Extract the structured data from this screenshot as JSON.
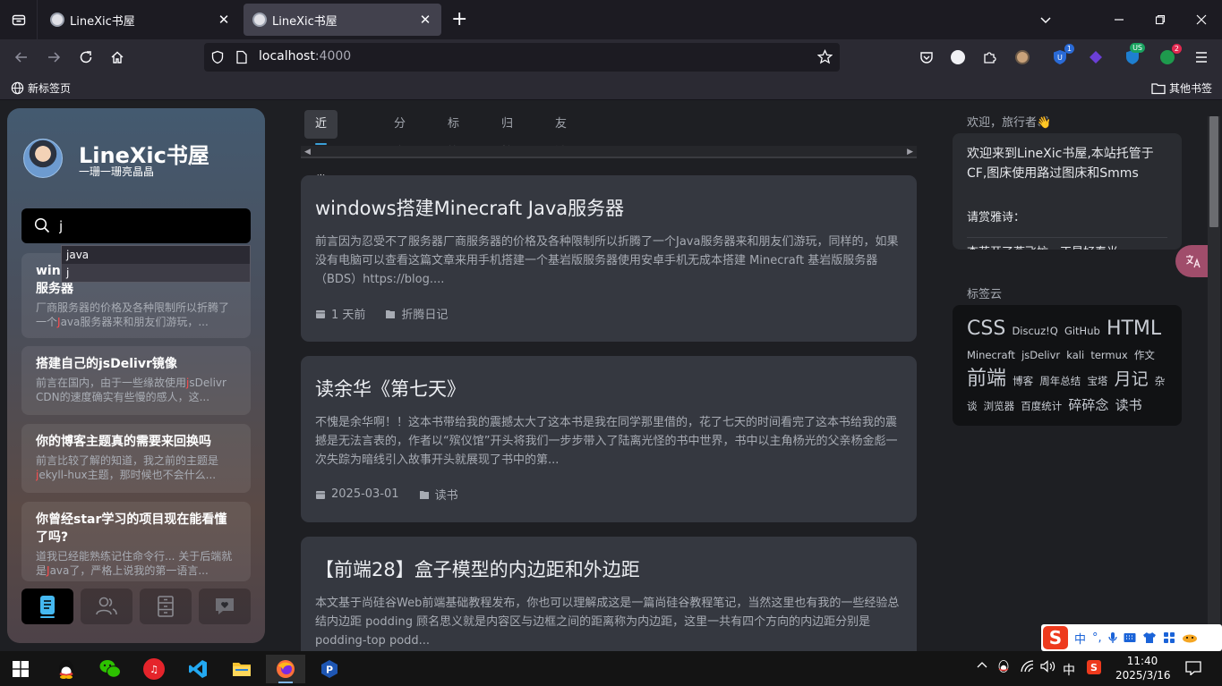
{
  "browser": {
    "tabs": [
      {
        "title": "LineXic书屋",
        "active": false
      },
      {
        "title": "LineXic书屋",
        "active": true
      }
    ],
    "url": {
      "host": "localhost",
      "port": ":4000"
    },
    "bookmarks": {
      "new_tab": "新标签页",
      "other": "其他书签"
    },
    "badges": {
      "ext1": "1",
      "ext_us": "US",
      "ext_count": "2"
    }
  },
  "sidebar": {
    "site_title": "LineXic书屋",
    "subtitle": "一珊一珊亮晶晶",
    "search": {
      "value": "j"
    },
    "autocomplete": [
      "java",
      "j"
    ],
    "results": [
      {
        "title": "windows搭建Minecraft Java服务器",
        "ex_a": "厂商服务器的价格及各种限制所以折腾了一个",
        "ex_hl": "J",
        "ex_b": "ava服务器来和朋友们游玩，..."
      },
      {
        "title": "搭建自己的jsDelivr镜像",
        "ex_a": "前言在国内，由于一些缘故使用",
        "ex_hl": "j",
        "ex_b": "sDelivr CDN的速度确实有些慢的感人，这..."
      },
      {
        "title": "你的博客主题真的需要来回换吗",
        "ex_a": "前言比较了解的知道，我之前的主题是",
        "ex_hl": "j",
        "ex_b": "ekyll-hux主题，那时候也不会什么..."
      },
      {
        "title": "你曾经star学习的项目现在能看懂了吗?",
        "ex_a": "道我已经能熟练记住命令行... 关于后端就是",
        "ex_hl": "J",
        "ex_b": "ava了，严格上说我的第一语言..."
      }
    ]
  },
  "main": {
    "tabs": [
      "近期发布",
      "分类",
      "标签",
      "归档",
      "友链"
    ],
    "articles": [
      {
        "title": "windows搭建Minecraft Java服务器",
        "excerpt": "前言因为忍受不了服务器厂商服务器的价格及各种限制所以折腾了一个Java服务器来和朋友们游玩，同样的，如果没有电脑可以查看这篇文章来用手机搭建一个基岩版服务器使用安卓手机无成本搭建 Minecraft 基岩版服务器（BDS）https://blog....",
        "date": "1 天前",
        "category": "折腾日记"
      },
      {
        "title": "读余华《第七天》",
        "excerpt": "不愧是余华啊！！这本书带给我的震撼太大了这本书是我在同学那里借的，花了七天的时间看完了这本书给我的震撼是无法言表的，作者以“殡仪馆”开头将我们一步步带入了陆离光怪的书中世界，书中以主角杨光的父亲杨金彪一次失踪为暗线引入故事开头就展现了书中的第...",
        "date": "2025-03-01",
        "category": "读书"
      },
      {
        "title": "【前端28】盒子模型的内边距和外边距",
        "excerpt": "本文基于尚硅谷Web前端基础教程发布，你也可以理解成这是一篇尚硅谷教程笔记，当然这里也有我的一些经验总结内边距 podding 顾名思义就是内容区与边框之间的距离称为内边距，这里一共有四个方向的内边距分别是 podding-top podd...",
        "date": "",
        "category": ""
      }
    ]
  },
  "right": {
    "welcome_head": "欢迎，旅行者👋",
    "welcome_text": "欢迎来到LineXic书屋,本站托管于CF,图床使用路过图床和Smms",
    "poem_label": "请赏雅诗：",
    "poem": "杏花开了燕飞忙，正是好春光。",
    "tags_head": "标签云",
    "tags": [
      {
        "t": "CSS",
        "s": "xl"
      },
      {
        "t": "Discuz!Q",
        "s": "s"
      },
      {
        "t": "GitHub",
        "s": "s"
      },
      {
        "t": "HTML",
        "s": "xl"
      },
      {
        "t": "Minecraft",
        "s": "s"
      },
      {
        "t": "jsDelivr",
        "s": "s"
      },
      {
        "t": "kali",
        "s": "s"
      },
      {
        "t": "termux",
        "s": "s"
      },
      {
        "t": "作文",
        "s": "s"
      },
      {
        "t": "前端",
        "s": "xl"
      },
      {
        "t": "博客",
        "s": "s"
      },
      {
        "t": "周年总结",
        "s": "s"
      },
      {
        "t": "宝塔",
        "s": "s"
      },
      {
        "t": "月记",
        "s": "l"
      },
      {
        "t": "杂谈",
        "s": "s"
      },
      {
        "t": "浏览器",
        "s": "s"
      },
      {
        "t": "百度统计",
        "s": "s"
      },
      {
        "t": "碎碎念",
        "s": "m"
      },
      {
        "t": "读书",
        "s": "m"
      }
    ]
  },
  "ime": {
    "mode": "中",
    "punct": "°,"
  },
  "taskbar": {
    "time": "11:40",
    "date": "2025/3/16",
    "lang": "中"
  },
  "colors": {
    "accent": "#3aa0d8",
    "highlight": "#ff4d4f",
    "card": "#353840"
  }
}
